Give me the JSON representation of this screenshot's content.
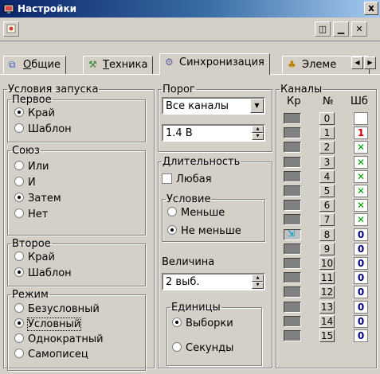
{
  "window": {
    "title": "Настройки",
    "close_glyph": "x"
  },
  "toolbar": {
    "pin_icon": "pin-icon",
    "btn1_glyph": "◫",
    "btn2_glyph": "▁",
    "btn3_glyph": "✕"
  },
  "tabs": [
    {
      "label_u": "О",
      "label_rest": "бщие",
      "icon": "general-icon"
    },
    {
      "label_u": "Т",
      "label_rest": "ехника",
      "icon": "hardware-icon"
    },
    {
      "label": "Синхронизация",
      "icon": "sync-icon",
      "active": true
    },
    {
      "label": "Элеме",
      "icon": "elements-icon"
    }
  ],
  "start_conditions": {
    "title": "Условия запуска",
    "first": {
      "title": "Первое",
      "options": [
        "Край",
        "Шаблон"
      ],
      "selected": "Край"
    },
    "union": {
      "title": "Союз",
      "options": [
        "Или",
        "И",
        "Затем",
        "Нет"
      ],
      "selected": "Затем"
    },
    "second": {
      "title": "Второе",
      "options": [
        "Край",
        "Шаблон"
      ],
      "selected": "Шаблон"
    },
    "mode": {
      "title": "Режим",
      "options": [
        "Безусловный",
        "Условный",
        "Однократный",
        "Самописец"
      ],
      "selected": "Условный"
    }
  },
  "threshold": {
    "title": "Порог",
    "channel_select": "Все каналы",
    "value": "1.4 В"
  },
  "duration": {
    "title": "Длительность",
    "any_label": "Любая",
    "any_checked": false,
    "condition": {
      "title": "Условие",
      "options": [
        "Меньше",
        "Не меньше"
      ],
      "selected": "Не меньше"
    },
    "magnitude_label": "Величина",
    "magnitude_value": "2 выб.",
    "units": {
      "title": "Единицы",
      "options": [
        "Выборки",
        "Секунды"
      ],
      "selected": "Выборки"
    }
  },
  "channels": {
    "title": "Каналы",
    "headers": {
      "kr": "Кр",
      "num": "№",
      "sh": "Шб"
    },
    "rows": [
      {
        "num": "0",
        "state": "",
        "color": "#000000"
      },
      {
        "num": "1",
        "state": "1",
        "color": "#cc0000"
      },
      {
        "num": "2",
        "state": "✕",
        "color": "#00a000"
      },
      {
        "num": "3",
        "state": "✕",
        "color": "#00a000"
      },
      {
        "num": "4",
        "state": "✕",
        "color": "#00a000"
      },
      {
        "num": "5",
        "state": "✕",
        "color": "#00a000"
      },
      {
        "num": "6",
        "state": "✕",
        "color": "#00a000"
      },
      {
        "num": "7",
        "state": "✕",
        "color": "#00a000"
      },
      {
        "num": "8",
        "state": "0",
        "color": "#000080",
        "marker": true
      },
      {
        "num": "9",
        "state": "0",
        "color": "#000080"
      },
      {
        "num": "10",
        "state": "0",
        "color": "#000080"
      },
      {
        "num": "11",
        "state": "0",
        "color": "#000080"
      },
      {
        "num": "12",
        "state": "0",
        "color": "#000080"
      },
      {
        "num": "13",
        "state": "0",
        "color": "#000080"
      },
      {
        "num": "14",
        "state": "0",
        "color": "#000080"
      },
      {
        "num": "15",
        "state": "0",
        "color": "#000080"
      }
    ]
  }
}
